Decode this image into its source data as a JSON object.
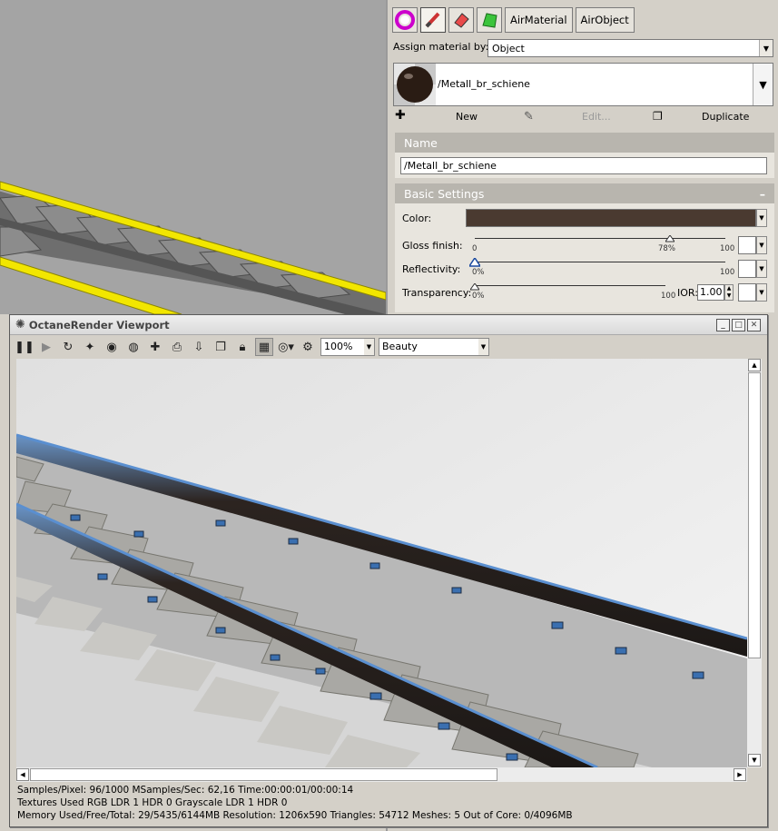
{
  "material_panel": {
    "toolbar": {
      "air_material_label": "AirMaterial",
      "air_object_label": "AirObject"
    },
    "assign_by": {
      "label": "Assign material by:",
      "value": "Object"
    },
    "current_material": "/Metall_br_schiene",
    "actions": {
      "new": "New",
      "edit": "Edit...",
      "duplicate": "Duplicate"
    },
    "name_section": {
      "title": "Name",
      "value": "/Metall_br_schiene"
    },
    "basic_section": {
      "title": "Basic Settings",
      "collapse_glyph": "–",
      "color_label": "Color:",
      "color_value": "#4a3a30",
      "gloss": {
        "label": "Gloss finish:",
        "min": "0",
        "max": "100",
        "value": "78%",
        "fraction": 0.78
      },
      "reflectivity": {
        "label": "Reflectivity:",
        "max": "100",
        "value": "0%",
        "fraction": 0.0
      },
      "transparency": {
        "label": "Transparency:",
        "max": "100",
        "value": "0%",
        "fraction": 0.0,
        "ior_label": "IOR:",
        "ior_value": "1.00"
      }
    }
  },
  "octane": {
    "title": "OctaneRender Viewport",
    "zoom": "100%",
    "pass": "Beauty",
    "status": {
      "line1": "Samples/Pixel: 96/1000  MSamples/Sec: 62,16  Time:00:00:01/00:00:14",
      "line2": "Textures Used RGB LDR 1  HDR 0  Grayscale LDR 1  HDR 0",
      "line3": "Memory Used/Free/Total: 29/5435/6144MB  Resolution: 1206x590  Triangles: 54712  Meshes: 5 Out of Core: 0/4096MB"
    }
  },
  "colors": {
    "rail_yellow": "#f2e600",
    "rail_blue": "#5a8fd0",
    "panel_bg": "#d4d0c8"
  }
}
